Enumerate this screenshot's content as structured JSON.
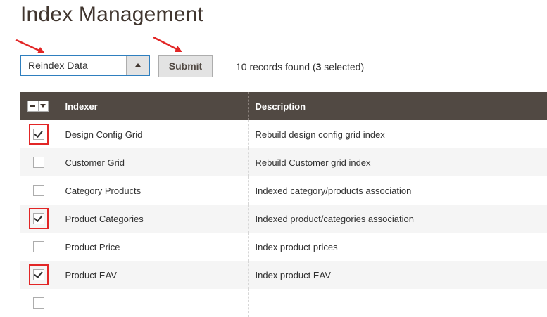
{
  "page": {
    "title": "Index Management"
  },
  "actions": {
    "select_value": "Reindex Data",
    "submit_label": "Submit",
    "records_prefix": "10 records found (",
    "records_selected": "3",
    "records_suffix": " selected)"
  },
  "grid": {
    "columns": [
      "Indexer",
      "Description"
    ],
    "rows": [
      {
        "indexer": "Design Config Grid",
        "description": "Rebuild design config grid index",
        "checked": true
      },
      {
        "indexer": "Customer Grid",
        "description": "Rebuild Customer grid index",
        "checked": false
      },
      {
        "indexer": "Category Products",
        "description": "Indexed category/products association",
        "checked": false
      },
      {
        "indexer": "Product Categories",
        "description": "Indexed product/categories association",
        "checked": true
      },
      {
        "indexer": "Product Price",
        "description": "Index product prices",
        "checked": false
      },
      {
        "indexer": "Product EAV",
        "description": "Index product EAV",
        "checked": true
      },
      {
        "indexer": "",
        "description": "",
        "checked": false
      }
    ]
  },
  "icons": {
    "select_toggle": "caret-up-icon",
    "mass_select": "mass-select-dropdown-icon",
    "annotation": "red-arrow-icon"
  },
  "colors": {
    "header_bg": "#514943",
    "annotation_red": "#e22626",
    "select_border": "#2f7fbf"
  }
}
